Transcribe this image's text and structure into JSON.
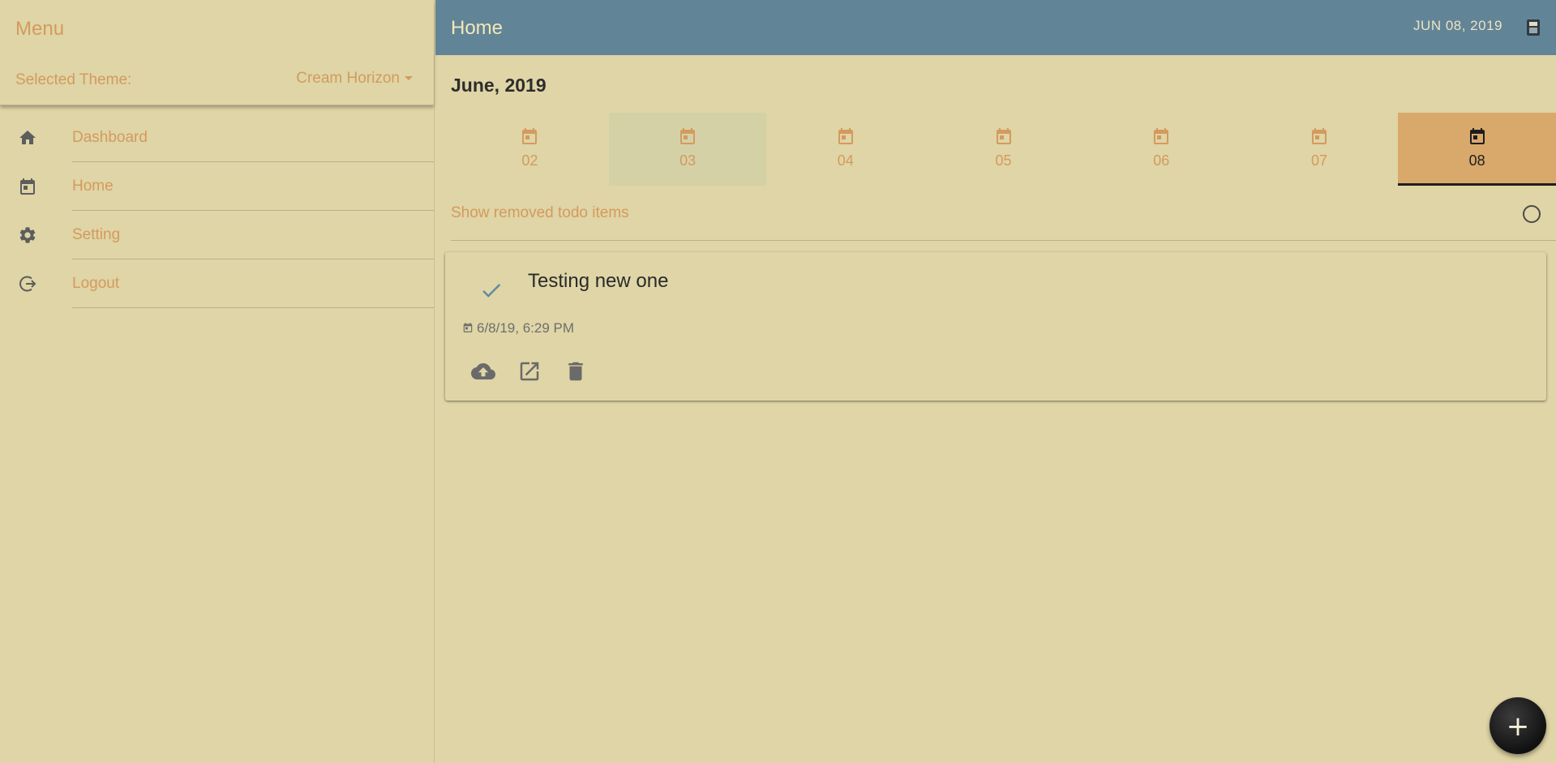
{
  "sidebar": {
    "title": "Menu",
    "theme_label": "Selected Theme:",
    "theme_value": "Cream Horizon",
    "items": [
      {
        "label": "Dashboard",
        "icon": "home-icon"
      },
      {
        "label": "Home",
        "icon": "calendar-icon"
      },
      {
        "label": "Setting",
        "icon": "gear-icon"
      },
      {
        "label": "Logout",
        "icon": "logout-icon"
      }
    ]
  },
  "header": {
    "title": "Home",
    "date": "JUN 08, 2019",
    "calculator_icon": "calculator-icon"
  },
  "calendar": {
    "month": "June, 2019",
    "days": [
      {
        "label": "02"
      },
      {
        "label": "03"
      },
      {
        "label": "04"
      },
      {
        "label": "05"
      },
      {
        "label": "06"
      },
      {
        "label": "07"
      },
      {
        "label": "08"
      }
    ],
    "selected_day": "08"
  },
  "filters": {
    "show_removed_label": "Show removed todo items"
  },
  "todos": [
    {
      "title": "Testing new one",
      "timestamp": "6/8/19, 6:29 PM",
      "done_icon": "check-icon",
      "actions": [
        "cloud-upload-icon",
        "open-in-new-icon",
        "delete-icon"
      ]
    }
  ],
  "fab": {
    "label": "+"
  },
  "colors": {
    "background": "#dfd5a6",
    "header": "#628497",
    "accent": "#d49a5e",
    "active_tab": "#d9a96b"
  }
}
